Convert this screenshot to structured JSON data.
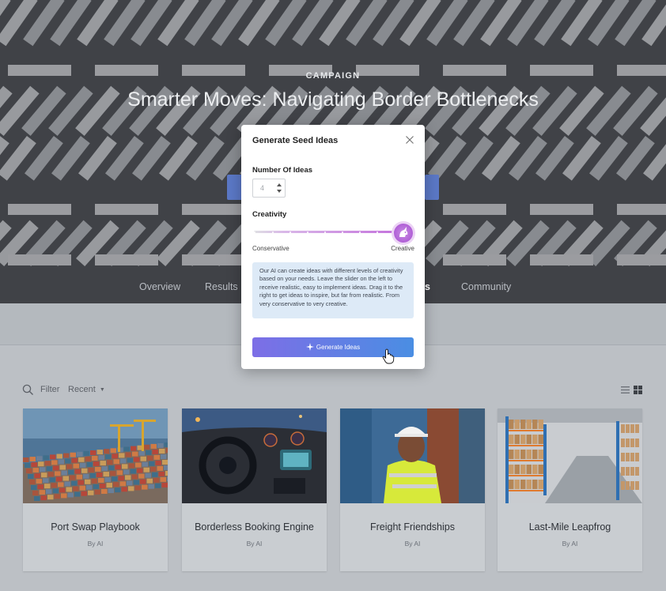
{
  "hero": {
    "label": "CAMPAIGN",
    "title": "Smarter Moves: Navigating Border Bottlenecks"
  },
  "tabs": [
    {
      "label": "Overview"
    },
    {
      "label": "Results"
    },
    {
      "label": "as"
    },
    {
      "label": "Community"
    }
  ],
  "toolbar": {
    "filter_label": "Filter",
    "sort_value": "Recent"
  },
  "cards": [
    {
      "title": "Port Swap Playbook",
      "author": "By AI"
    },
    {
      "title": "Borderless Booking Engine",
      "author": "By AI"
    },
    {
      "title": "Freight Friendships",
      "author": "By AI"
    },
    {
      "title": "Last-Mile Leapfrog",
      "author": "By AI"
    }
  ],
  "modal": {
    "title": "Generate Seed Ideas",
    "ideas_label": "Number Of Ideas",
    "ideas_value": "4",
    "creativity_label": "Creativity",
    "creativity_level": 1.0,
    "low_label": "Conservative",
    "high_label": "Creative",
    "info": "Our AI can create ideas with different levels of creativity based on your needs. Leave the slider on the left to receive realistic, easy to implement ideas. Drag it to the right to get ideas to inspire, but far from realistic. From very conservative to very creative.",
    "button_label": "Generate Ideas"
  },
  "colors": {
    "accent_purple": "#b05fd6",
    "button_start": "#7d6ee6",
    "button_end": "#4a8ee3",
    "info_bg": "#ddeaf7"
  }
}
